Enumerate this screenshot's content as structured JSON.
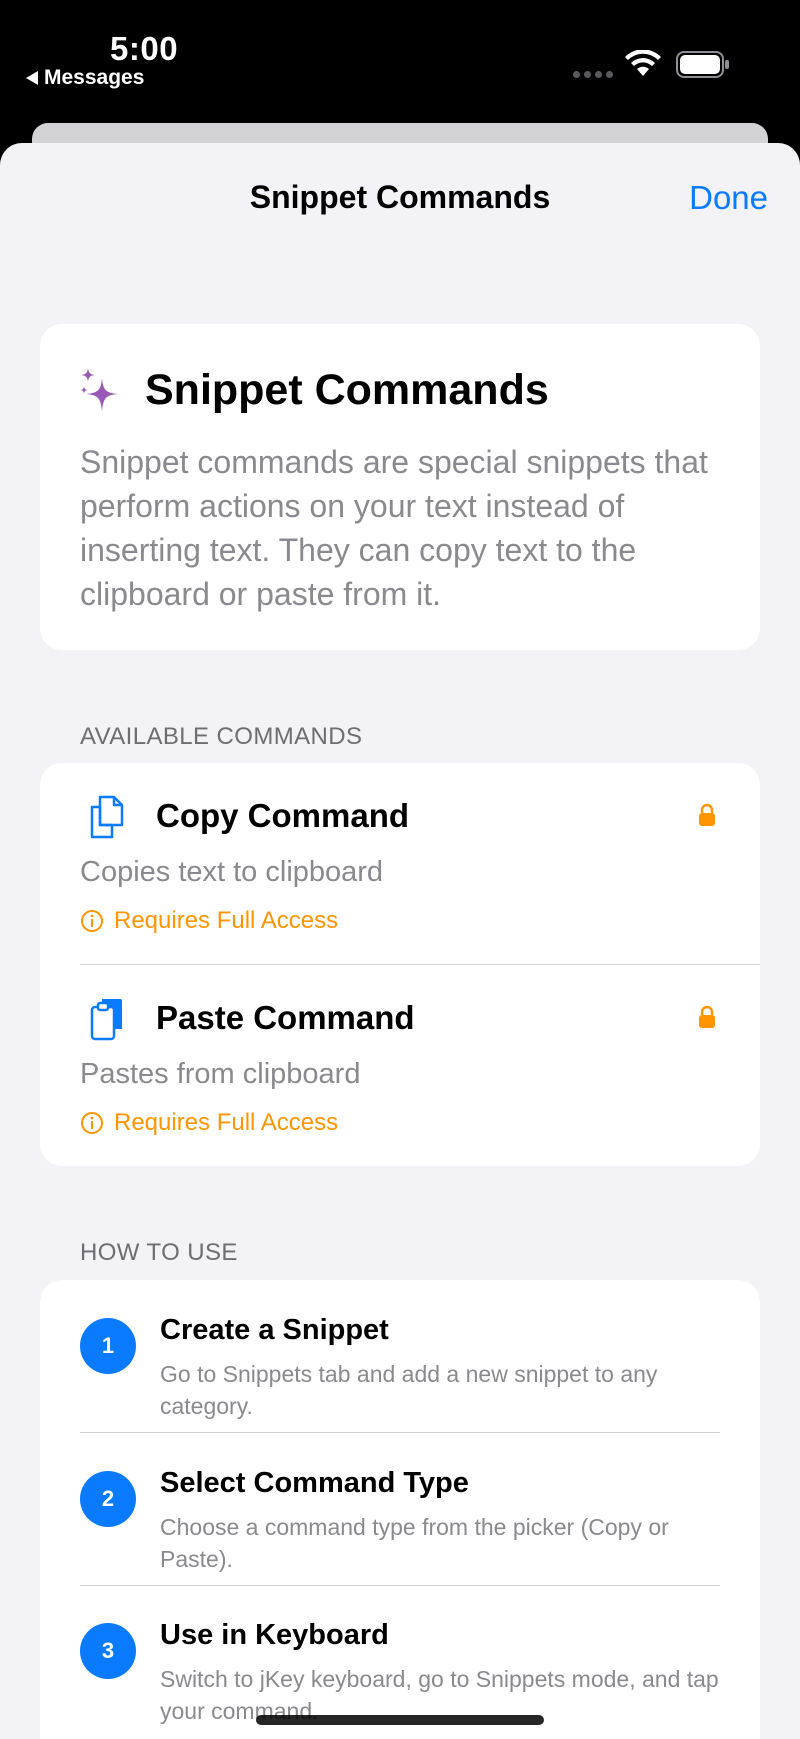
{
  "status_bar": {
    "time": "5:00",
    "back_label": "Messages"
  },
  "nav": {
    "title": "Snippet Commands",
    "done_label": "Done"
  },
  "intro": {
    "title": "Snippet Commands",
    "description": "Snippet commands are special snippets that perform actions on your text instead of inserting text. They can copy text to the clipboard or paste from it.",
    "icon": "sparkles-icon"
  },
  "available_commands": {
    "header": "AVAILABLE COMMANDS",
    "items": [
      {
        "title": "Copy Command",
        "description": "Copies text to clipboard",
        "access": "Requires Full Access",
        "icon": "copy-document-icon"
      },
      {
        "title": "Paste Command",
        "description": "Pastes from clipboard",
        "access": "Requires Full Access",
        "icon": "paste-clipboard-icon"
      }
    ]
  },
  "how_to_use": {
    "header": "HOW TO USE",
    "steps": [
      {
        "number": "1",
        "title": "Create a Snippet",
        "description": "Go to Snippets tab and add a new snippet to any category."
      },
      {
        "number": "2",
        "title": "Select Command Type",
        "description": "Choose a command type from the picker (Copy or Paste)."
      },
      {
        "number": "3",
        "title": "Use in Keyboard",
        "description": "Switch to jKey keyboard, go to Snippets mode, and tap your command."
      }
    ]
  },
  "colors": {
    "accent": "#0a7aff",
    "warning": "#ff9500",
    "sparkle": "#9b59b6",
    "background": "#f2f2f7"
  }
}
